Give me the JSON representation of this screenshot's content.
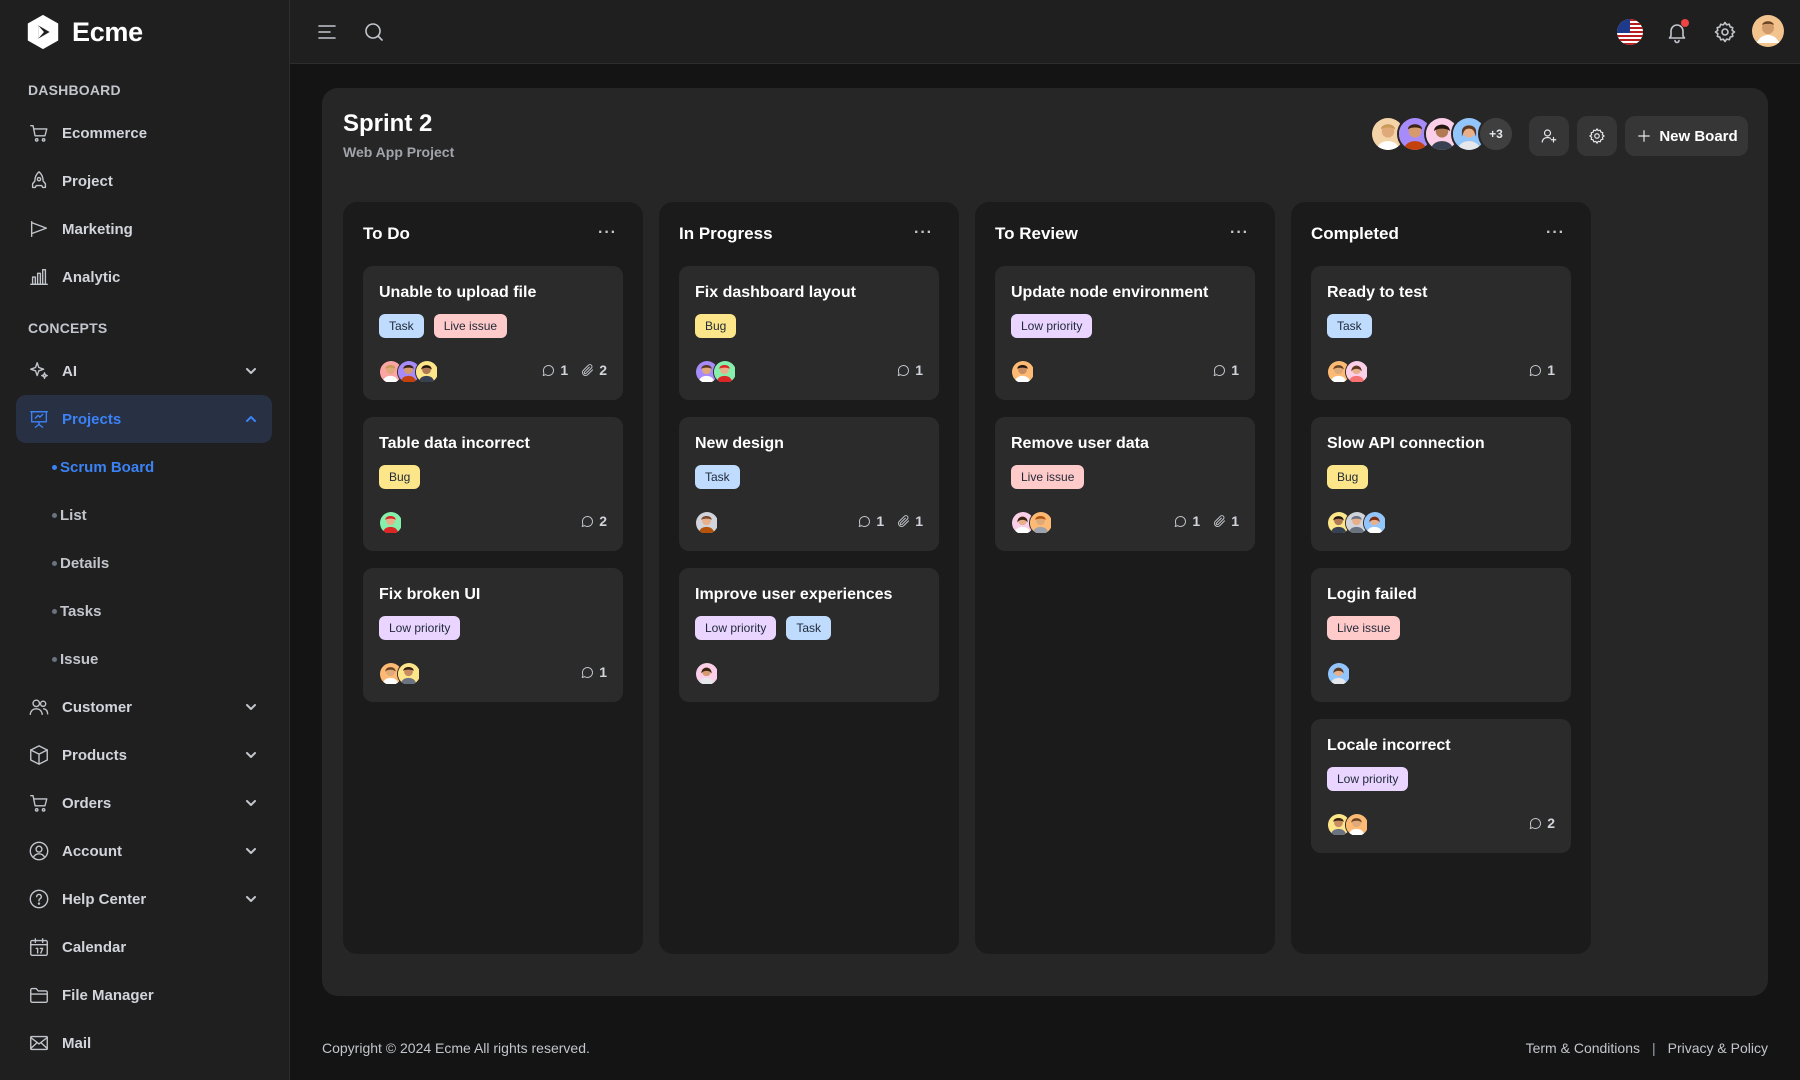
{
  "app": {
    "name": "Ecme"
  },
  "sidebar": {
    "dashboard_title": "DASHBOARD",
    "concepts_title": "CONCEPTS",
    "dashboard_items": [
      {
        "label": "Ecommerce",
        "icon": "cart-icon"
      },
      {
        "label": "Project",
        "icon": "rocket-icon"
      },
      {
        "label": "Marketing",
        "icon": "megaphone-icon"
      },
      {
        "label": "Analytic",
        "icon": "bar-chart-icon"
      }
    ],
    "concept_items": [
      {
        "label": "AI",
        "icon": "sparkles-icon"
      },
      {
        "label": "Projects",
        "icon": "presentation-icon"
      }
    ],
    "project_subitems": [
      "Scrum Board",
      "List",
      "Details",
      "Tasks",
      "Issue"
    ],
    "lower_items": [
      {
        "label": "Customer",
        "icon": "users-icon"
      },
      {
        "label": "Products",
        "icon": "box-icon"
      },
      {
        "label": "Orders",
        "icon": "cart-icon"
      },
      {
        "label": "Account",
        "icon": "user-circle-icon"
      },
      {
        "label": "Help Center",
        "icon": "help-icon"
      },
      {
        "label": "Calendar",
        "icon": "calendar-icon"
      },
      {
        "label": "File Manager",
        "icon": "folder-icon"
      },
      {
        "label": "Mail",
        "icon": "mail-icon"
      }
    ]
  },
  "board": {
    "title": "Sprint 2",
    "subtitle": "Web App Project",
    "more_members": "+3",
    "new_board_label": "New Board",
    "columns": [
      {
        "title": "To Do",
        "menu": "···"
      },
      {
        "title": "In Progress",
        "menu": "···"
      },
      {
        "title": "To Review",
        "menu": "···"
      },
      {
        "title": "Completed",
        "menu": "···"
      }
    ],
    "cards": {
      "todo": [
        {
          "title": "Unable to upload file",
          "tags": [
            "Task",
            "Live issue"
          ],
          "comments": "1",
          "attachments": "2"
        },
        {
          "title": "Table data incorrect",
          "tags": [
            "Bug"
          ],
          "comments": "2"
        },
        {
          "title": "Fix broken UI",
          "tags": [
            "Low priority"
          ],
          "comments": "1"
        }
      ],
      "progress": [
        {
          "title": "Fix dashboard layout",
          "tags": [
            "Bug"
          ],
          "comments": "1"
        },
        {
          "title": "New design",
          "tags": [
            "Task"
          ],
          "comments": "1",
          "attachments": "1"
        },
        {
          "title": "Improve user experiences",
          "tags": [
            "Low priority",
            "Task"
          ]
        }
      ],
      "review": [
        {
          "title": "Update node environment",
          "tags": [
            "Low priority"
          ],
          "comments": "1"
        },
        {
          "title": "Remove user data",
          "tags": [
            "Live issue"
          ],
          "comments": "1",
          "attachments": "1"
        }
      ],
      "completed": [
        {
          "title": "Ready to test",
          "tags": [
            "Task"
          ],
          "comments": "1"
        },
        {
          "title": "Slow API connection",
          "tags": [
            "Bug"
          ]
        },
        {
          "title": "Login failed",
          "tags": [
            "Live issue"
          ]
        },
        {
          "title": "Locale incorrect",
          "tags": [
            "Low priority"
          ],
          "comments": "2"
        }
      ]
    }
  },
  "footer": {
    "copyright": "Copyright © 2024 Ecme All rights reserved.",
    "terms": "Term & Conditions",
    "separator": "|",
    "privacy": "Privacy & Policy"
  },
  "colors": {
    "accent": "#3b82f6",
    "tag_task": "#bfdbfe",
    "tag_bug": "#fde68a",
    "tag_live_issue": "#fecaca",
    "tag_low_priority": "#e9d5ff",
    "notification": "#ef4444"
  }
}
